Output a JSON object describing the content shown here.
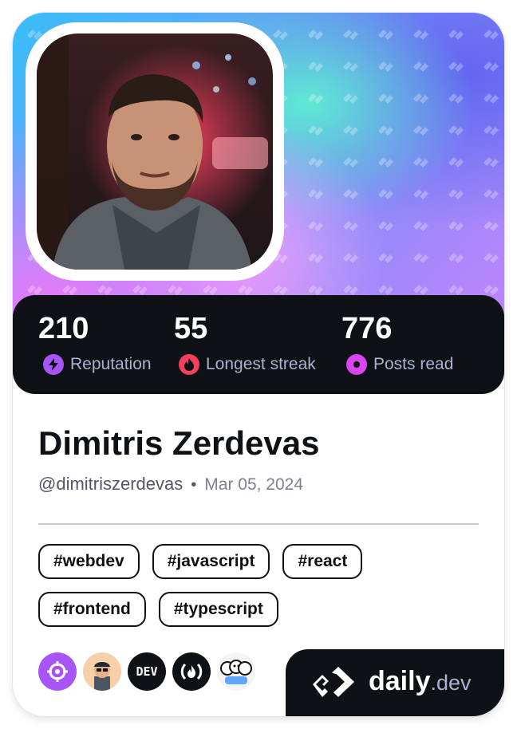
{
  "profile": {
    "name": "Dimitris Zerdevas",
    "handle": "@dimitriszerdevas",
    "separator": "•",
    "joined": "Mar 05, 2024",
    "avatar_icon": "user-photo"
  },
  "stats": [
    {
      "value": "210",
      "label": "Reputation",
      "icon": "bolt-icon",
      "color": "#a855f7"
    },
    {
      "value": "55",
      "label": "Longest streak",
      "icon": "flame-icon",
      "color": "#f43f5e"
    },
    {
      "value": "776",
      "label": "Posts read",
      "icon": "eye-icon",
      "color": "#d946ef"
    }
  ],
  "tags": [
    "#webdev",
    "#javascript",
    "#react",
    "#frontend",
    "#typescript"
  ],
  "sources": [
    {
      "name": "crosshair-source-icon",
      "color": "#a855f7"
    },
    {
      "name": "developer-avatar-source-icon",
      "color": "#f5d0a9"
    },
    {
      "name": "dev-source-icon",
      "color": "#0e1217",
      "text": "DEV"
    },
    {
      "name": "freecodecamp-source-icon",
      "color": "#0e1217",
      "text": "(🔥)"
    },
    {
      "name": "people-source-icon",
      "color": "#f3f4f6"
    }
  ],
  "brand": {
    "logo_icon": "daily-dev-logo-icon",
    "word1": "daily",
    "word2": ".dev"
  },
  "colors": {
    "dark": "#0e1217",
    "muted": "#a8b3cf",
    "accent": "#a855f7"
  }
}
